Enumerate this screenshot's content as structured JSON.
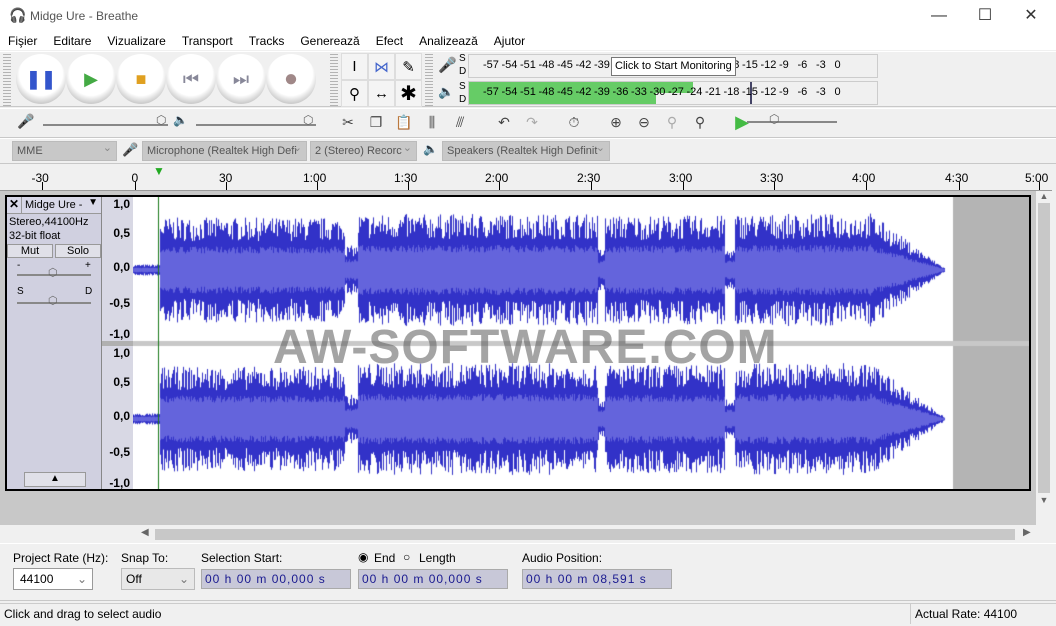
{
  "window": {
    "title": "Midge Ure - Breathe",
    "minimize": "—",
    "maximize": "☐",
    "close": "✕"
  },
  "menu": [
    "Fişier",
    "Editare",
    "Vizualizare",
    "Transport",
    "Tracks",
    "Generează",
    "Efect",
    "Analizează",
    "Ajutor"
  ],
  "transport": {
    "pause": "pause-icon",
    "play": "play-icon",
    "stop": "stop-icon",
    "skip_start": "skip-start-icon",
    "skip_end": "skip-end-icon",
    "record": "record-icon"
  },
  "meters": {
    "ticks": [
      "-57",
      "-54",
      "-51",
      "-48",
      "-45",
      "-42",
      "-39",
      "-36",
      "-33",
      "-30",
      "-27",
      "-24",
      "-21",
      "-18",
      "-15",
      "-12",
      "-9",
      "-6",
      "-3",
      "0"
    ],
    "left_label": "S",
    "right_label": "D",
    "tooltip": "Click to Start Monitoring",
    "playback_level_left_db": -24,
    "playback_level_right_db": -30,
    "peak_db": -15,
    "color": "#66cc66"
  },
  "devices": {
    "host": "MME",
    "mic": "Microphone (Realtek High Defi",
    "channels": "2 (Stereo) Recorc",
    "speakers": "Speakers (Realtek High Definit"
  },
  "ruler": {
    "ticks": [
      "-30",
      "0",
      "30",
      "1:00",
      "1:30",
      "2:00",
      "2:30",
      "3:00",
      "3:30",
      "4:00",
      "4:30",
      "5:00"
    ]
  },
  "track": {
    "name": "Midge Ure -",
    "info1": "Stereo,44100Hz",
    "info2": "32-bit float",
    "mute": "Mut",
    "solo": "Solo",
    "gain_minus": "-",
    "gain_plus": "+",
    "pan_left": "S",
    "pan_right": "D",
    "scale": [
      "1,0",
      "0,5",
      "0,0",
      "-0,5",
      "-1,0"
    ],
    "wave_color": "#3232c8"
  },
  "watermark": "AW-SOFTWARE.COM",
  "selection": {
    "rate_label": "Project Rate (Hz):",
    "rate": "44100",
    "snap_label": "Snap To:",
    "snap": "Off",
    "start_label": "Selection Start:",
    "end_label": "End",
    "length_label": "Length",
    "start": "00 h 00 m 00,000 s",
    "end": "00 h 00 m 00,000 s",
    "pos_label": "Audio Position:",
    "pos": "00 h 00 m 08,591 s"
  },
  "status": {
    "hint": "Click and drag to select audio",
    "rate": "Actual Rate: 44100"
  }
}
